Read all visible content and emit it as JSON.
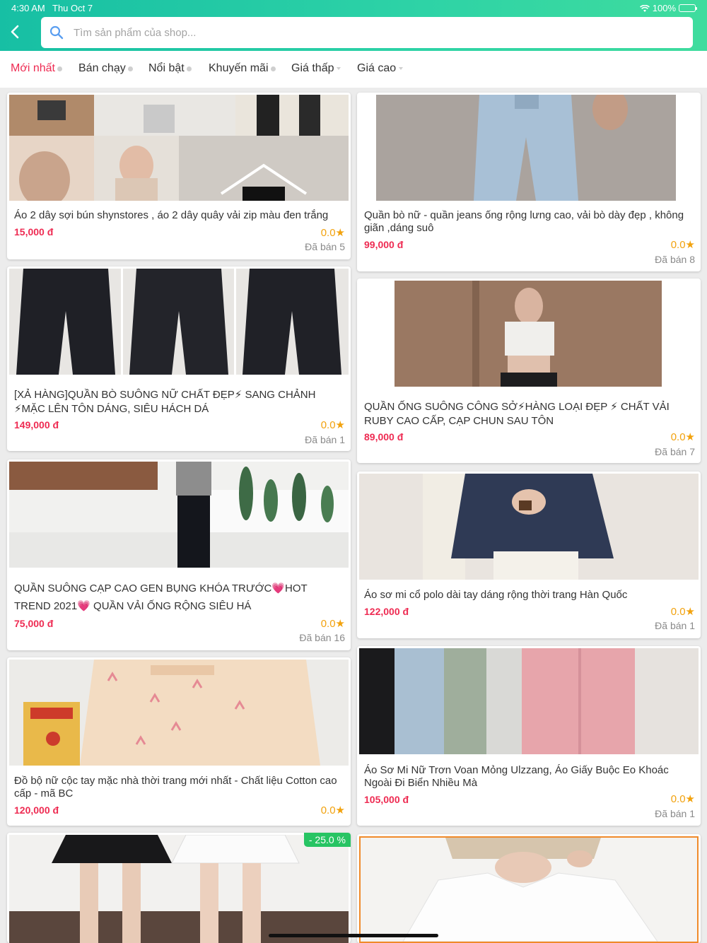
{
  "status": {
    "time": "4:30 AM",
    "date": "Thu Oct 7",
    "battery": "100%"
  },
  "header": {
    "search_placeholder": "Tìm sản phẩm của shop..."
  },
  "colors": {
    "accent": "#2ed3a6",
    "price": "#ee2b52",
    "rating": "#f2a20e",
    "discount": "#27c463"
  },
  "tabs": [
    {
      "label": "Mới nhất"
    },
    {
      "label": "Bán chạy"
    },
    {
      "label": "Nổi bật"
    },
    {
      "label": "Khuyến mãi"
    },
    {
      "label": "Giá thấp"
    },
    {
      "label": "Giá cao"
    }
  ],
  "products": [
    {
      "title": "Áo 2 dây sợi bún shynstores , áo 2 dây quây vải zip màu đen trắng",
      "price": "15,000 đ",
      "rating": "0.0",
      "sold": "Đã bán 5"
    },
    {
      "title": "Quần bò nữ - quần jeans ống rộng lưng cao, vải bò dày đẹp , không giãn ,dáng suô",
      "price": "99,000 đ",
      "rating": "0.0",
      "sold": "Đã bán 8"
    },
    {
      "title": "[XẢ HÀNG]QUẦN BÒ SUÔNG NỮ CHẤT ĐẸP⚡ SANG CHẢNH ⚡MẶC LÊN TÔN DÁNG, SIÊU HÁCH DÁ",
      "price": "149,000 đ",
      "rating": "0.0",
      "sold": "Đã bán 1"
    },
    {
      "title": "QUẦN ỐNG SUÔNG CÔNG SỞ⚡HÀNG LOẠI ĐẸP ⚡ CHẤT VẢI RUBY CAO CẤP, CẠP CHUN SAU TÔN",
      "price": "89,000 đ",
      "rating": "0.0",
      "sold": "Đã bán 7"
    },
    {
      "title": "QUẦN SUÔNG CẠP CAO GEN BỤNG KHÓA TRƯỚC💗HOT TREND 2021💗 QUẦN VẢI ỐNG RỘNG SIÊU HÁ",
      "price": "75,000 đ",
      "rating": "0.0",
      "sold": "Đã bán 16"
    },
    {
      "title": "Áo sơ mi cổ polo dài tay dáng rộng thời trang Hàn Quốc",
      "price": "122,000 đ",
      "rating": "0.0",
      "sold": "Đã bán 1"
    },
    {
      "title": "Đồ bộ nữ cộc tay mặc nhà thời trang mới nhất - Chất liệu Cotton cao cấp - mã BC",
      "price": "120,000 đ",
      "rating": "0.0",
      "sold": ""
    },
    {
      "title": "Áo Sơ Mi Nữ Trơn Voan Mỏng Ulzzang, Áo Giấy Buộc Eo Khoác Ngoài Đi Biển Nhiều Mà",
      "price": "105,000 đ",
      "rating": "0.0",
      "sold": "Đã bán 1"
    },
    {
      "title": "",
      "price": "",
      "rating": "",
      "sold": "",
      "discount": "- 25.0 %"
    },
    {
      "title": "",
      "price": "",
      "rating": "",
      "sold": ""
    }
  ],
  "thumbnails": [
    {
      "icon": "product-photo-tops-collage"
    },
    {
      "icon": "product-photo-jeans"
    },
    {
      "icon": "product-photo-black-jeans"
    },
    {
      "icon": "product-photo-white-crop-top"
    },
    {
      "icon": "product-photo-black-wide-pants"
    },
    {
      "icon": "product-photo-navy-shirt"
    },
    {
      "icon": "product-photo-flamingo-pajama"
    },
    {
      "icon": "product-photo-chiffon-shirts"
    },
    {
      "icon": "product-photo-skirts"
    },
    {
      "icon": "product-photo-white-tshirt"
    }
  ]
}
